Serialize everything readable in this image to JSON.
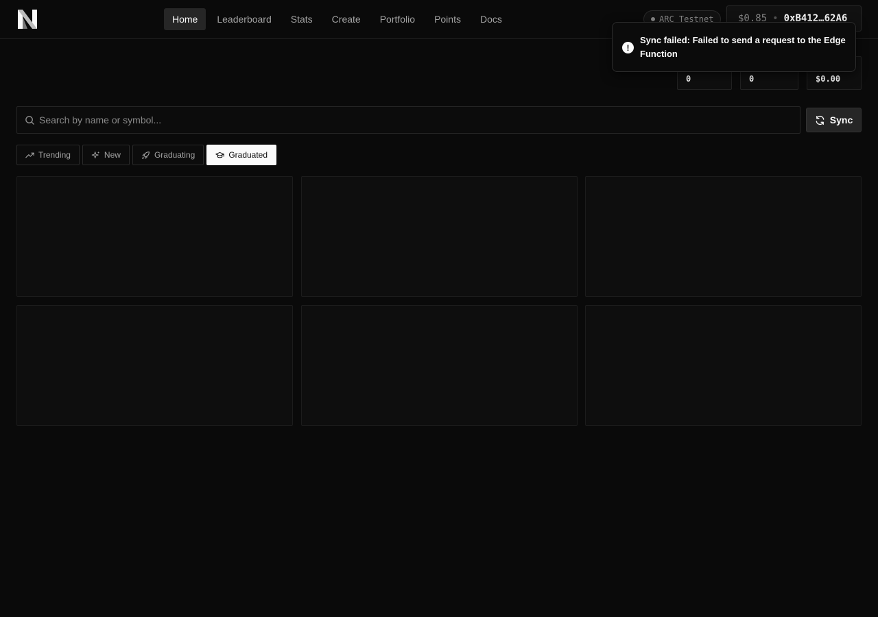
{
  "nav": {
    "items": [
      {
        "label": "Home",
        "active": true
      },
      {
        "label": "Leaderboard"
      },
      {
        "label": "Stats"
      },
      {
        "label": "Create"
      },
      {
        "label": "Portfolio"
      },
      {
        "label": "Points"
      },
      {
        "label": "Docs"
      }
    ]
  },
  "network": {
    "label": "ARC Testnet"
  },
  "wallet": {
    "balance": "$0.85",
    "separator": "•",
    "address": "0xB412…62A6"
  },
  "stats": [
    {
      "label": "",
      "value": "0"
    },
    {
      "label": "",
      "value": "0"
    },
    {
      "label": "",
      "value": "$0.00"
    }
  ],
  "toast": {
    "message": "Sync failed: Failed to send a request to the Edge Function",
    "icon": "alert-circle-icon"
  },
  "search": {
    "placeholder": "Search by name or symbol...",
    "value": ""
  },
  "sync_button": {
    "label": "Sync",
    "icon": "refresh-icon"
  },
  "tabs": [
    {
      "label": "Trending",
      "icon": "trending-up-icon"
    },
    {
      "label": "New",
      "icon": "sparkles-icon"
    },
    {
      "label": "Graduating",
      "icon": "rocket-icon"
    },
    {
      "label": "Graduated",
      "icon": "graduation-cap-icon",
      "active": true
    }
  ],
  "colors": {
    "background": "#0a0a0a",
    "active_tab": "#fafafa",
    "nav_active": "#262626"
  }
}
